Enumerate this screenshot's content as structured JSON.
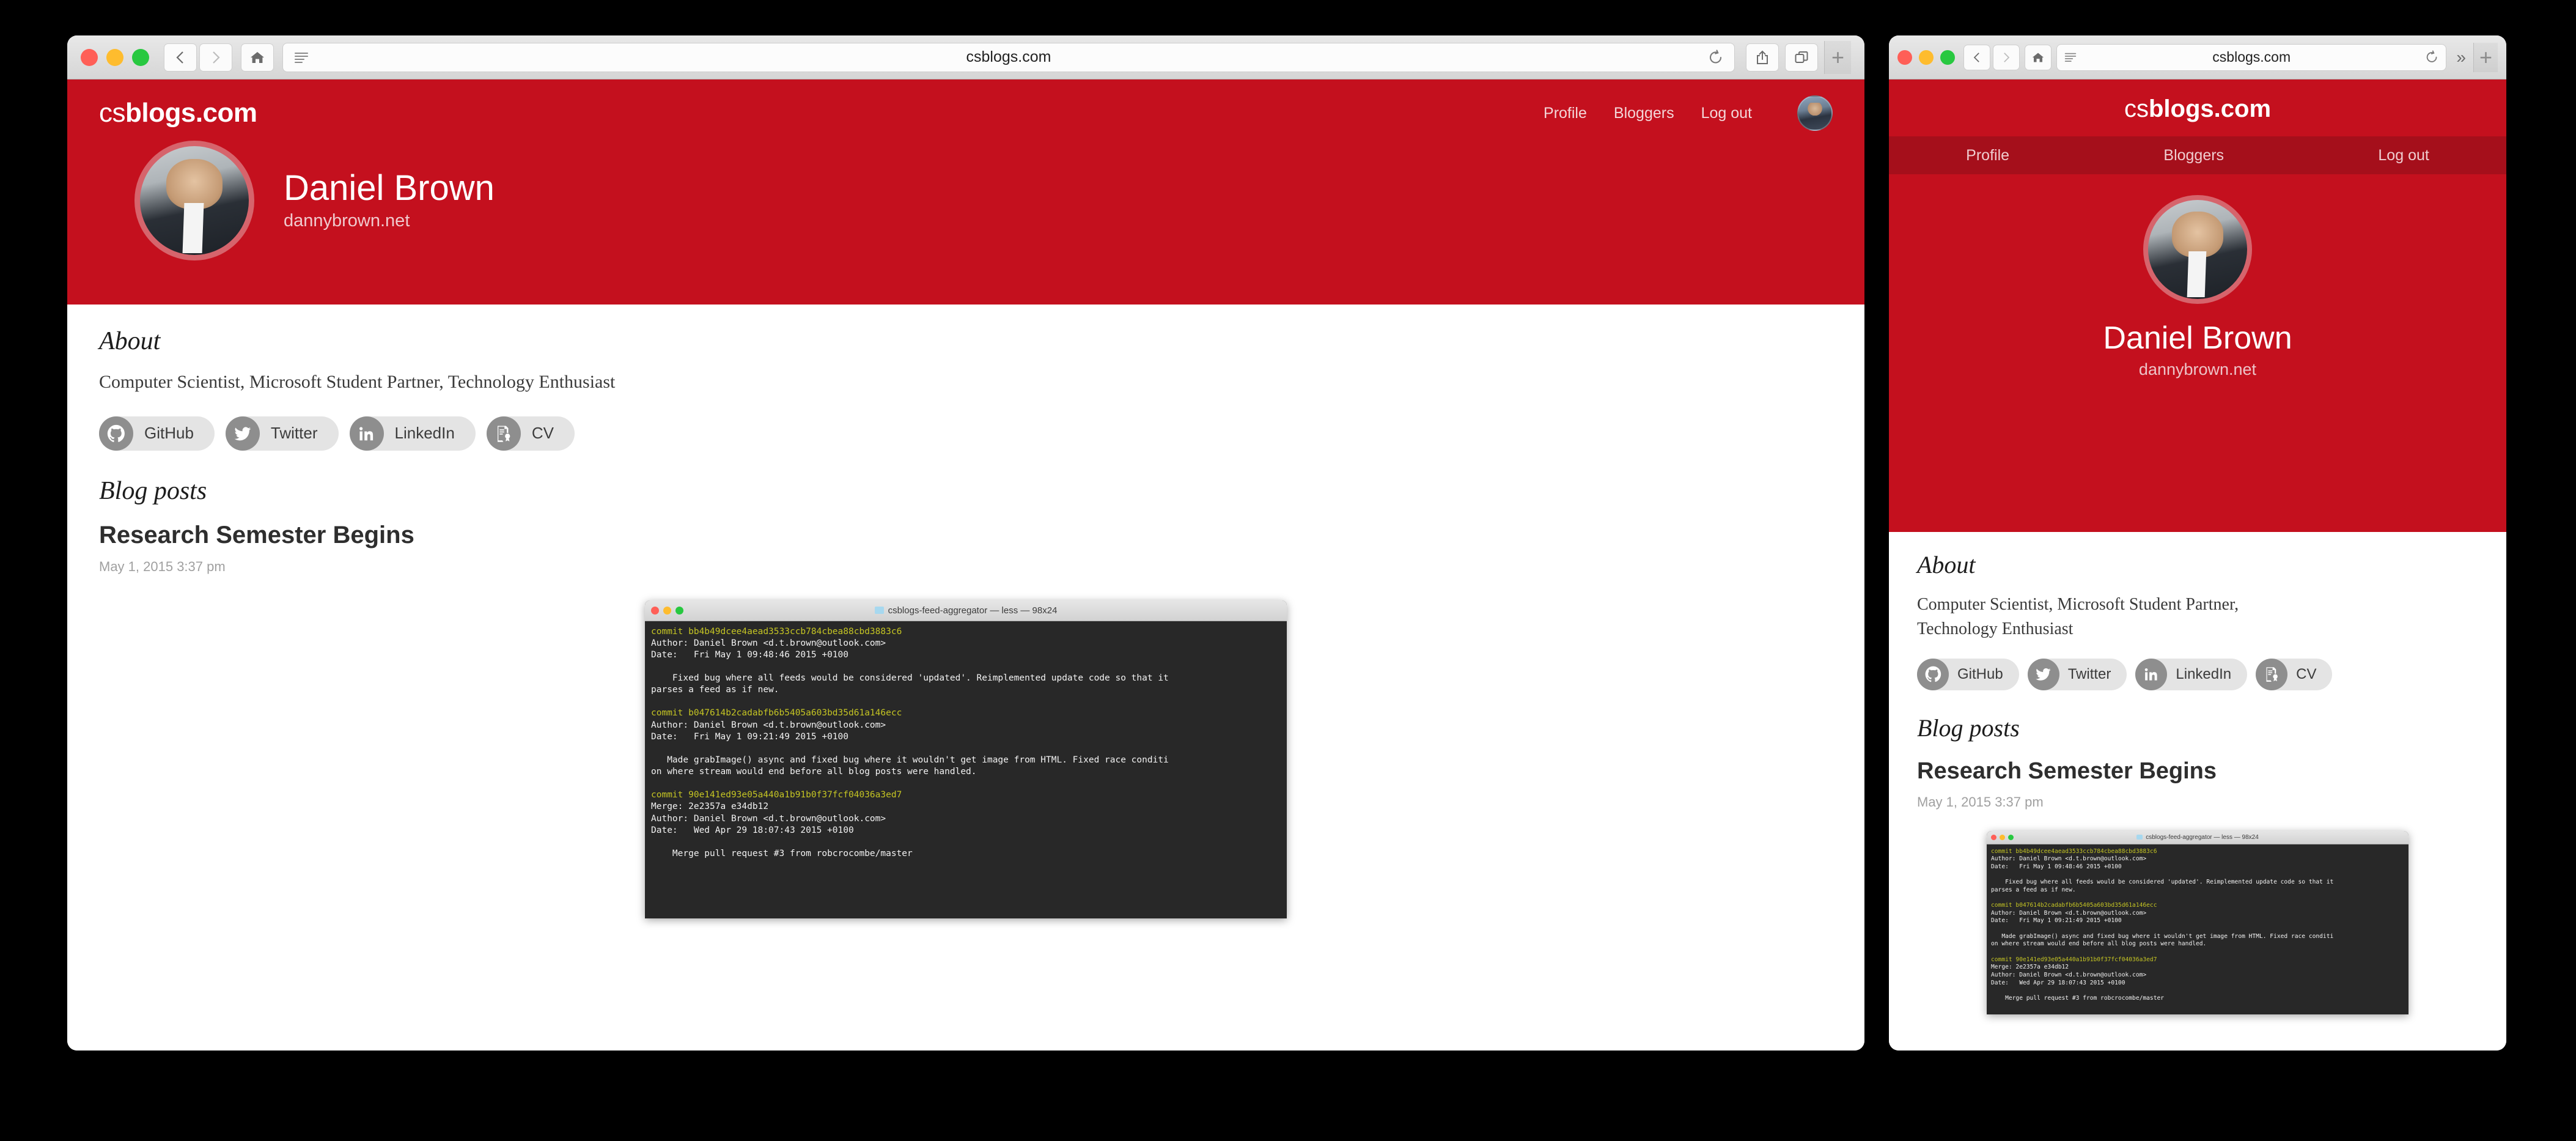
{
  "browser": {
    "desktop": {
      "url": "csblogs.com",
      "buttons": {
        "back": "back",
        "forward": "forward",
        "home": "home",
        "reader": "reader",
        "reload": "reload",
        "share": "share",
        "tabs": "tabs",
        "newtab": "+"
      }
    },
    "mobile": {
      "url": "csblogs.com",
      "overflow": "»",
      "newtab": "+"
    }
  },
  "site": {
    "logo": {
      "light": "cs",
      "bold": "blogs.com"
    },
    "nav": [
      {
        "label": "Profile"
      },
      {
        "label": "Bloggers"
      },
      {
        "label": "Log out"
      }
    ],
    "profile": {
      "name": "Daniel Brown",
      "website": "dannybrown.net"
    },
    "about": {
      "heading": "About",
      "text": "Computer Scientist, Microsoft Student Partner, Technology Enthusiast",
      "text_line1": "Computer Scientist, Microsoft Student Partner,",
      "text_line2": "Technology Enthusiast"
    },
    "social": [
      {
        "label": "GitHub",
        "icon": "github-icon"
      },
      {
        "label": "Twitter",
        "icon": "twitter-icon"
      },
      {
        "label": "LinkedIn",
        "icon": "linkedin-icon"
      },
      {
        "label": "CV",
        "icon": "certificate-icon"
      }
    ],
    "blog": {
      "heading": "Blog posts",
      "posts": [
        {
          "title": "Research Semester Begins",
          "date": "May 1, 2015 3:37 pm"
        }
      ]
    }
  },
  "terminal": {
    "title": "csblogs-feed-aggregator — less — 98x24",
    "lines": [
      {
        "type": "commit",
        "text": "commit bb4b49dcee4aead3533ccb784cbea88cbd3883c6"
      },
      {
        "type": "plain",
        "text": "Author: Daniel Brown <d.t.brown@outlook.com>"
      },
      {
        "type": "plain",
        "text": "Date:   Fri May 1 09:48:46 2015 +0100"
      },
      {
        "type": "plain",
        "text": ""
      },
      {
        "type": "plain",
        "text": "    Fixed bug where all feeds would be considered 'updated'. Reimplemented update code so that it"
      },
      {
        "type": "plain",
        "text": "parses a feed as if new."
      },
      {
        "type": "plain",
        "text": ""
      },
      {
        "type": "commit",
        "text": "commit b047614b2cadabfb6b5405a603bd35d61a146ecc"
      },
      {
        "type": "plain",
        "text": "Author: Daniel Brown <d.t.brown@outlook.com>"
      },
      {
        "type": "plain",
        "text": "Date:   Fri May 1 09:21:49 2015 +0100"
      },
      {
        "type": "plain",
        "text": ""
      },
      {
        "type": "plain",
        "text": "   Made grabImage() async and fixed bug where it wouldn't get image from HTML. Fixed race conditi"
      },
      {
        "type": "plain",
        "text": "on where stream would end before all blog posts were handled."
      },
      {
        "type": "plain",
        "text": ""
      },
      {
        "type": "commit",
        "text": "commit 90e141ed93e05a440a1b91b0f37fcf04036a3ed7"
      },
      {
        "type": "plain",
        "text": "Merge: 2e2357a e34db12"
      },
      {
        "type": "plain",
        "text": "Author: Daniel Brown <d.t.brown@outlook.com>"
      },
      {
        "type": "plain",
        "text": "Date:   Wed Apr 29 18:07:43 2015 +0100"
      },
      {
        "type": "plain",
        "text": ""
      },
      {
        "type": "plain",
        "text": "    Merge pull request #3 from robcrocombe/master"
      }
    ]
  },
  "colors": {
    "brand_red": "#c4101e",
    "nav_red": "#a50f1b",
    "avatar_ring": "#d6646c",
    "pill_bg": "#e4e4e4",
    "pill_icon": "#8e8e8e",
    "terminal_bg": "#282828",
    "commit_yellow": "#c5c523"
  }
}
